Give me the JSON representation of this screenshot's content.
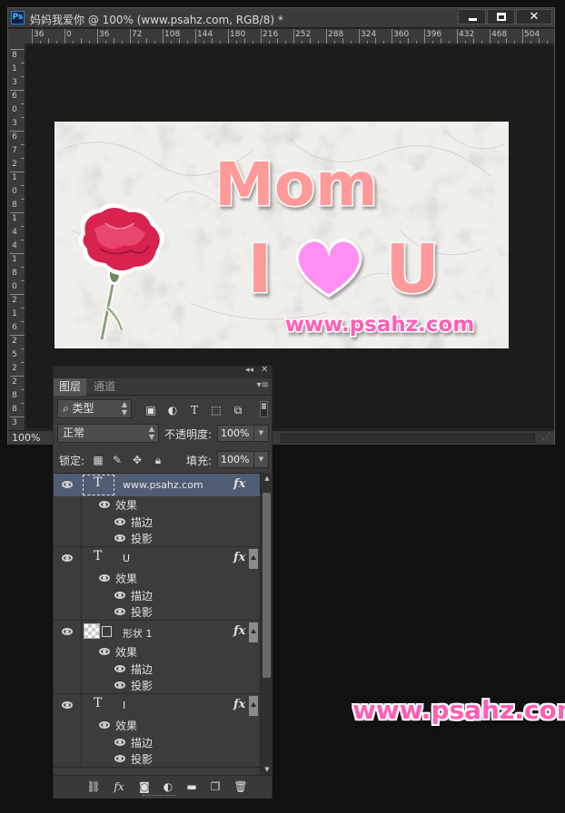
{
  "document": {
    "app_icon_label": "Ps",
    "title": "妈妈我爱你 @ 100% (www.psahz.com, RGB/8) *",
    "zoom": "100%",
    "h_ruler_labels": [
      "36",
      "0",
      "36",
      "72",
      "108",
      "144",
      "180",
      "216",
      "252",
      "288",
      "324",
      "360",
      "396",
      "432",
      "468",
      "504"
    ],
    "v_ruler_labels": [
      "8",
      "1",
      "3",
      "6",
      "0",
      "3",
      "6",
      "7",
      "2",
      "1",
      "0",
      "8",
      "1",
      "4",
      "4",
      "1",
      "8",
      "0",
      "2",
      "1",
      "6",
      "2",
      "5",
      "2",
      "2",
      "8",
      "8",
      "3"
    ]
  },
  "artwork": {
    "line1": "Mom",
    "line2_left": "I",
    "line2_right": "U",
    "url": "www.psahz.com",
    "heart_color": "#ff8ff0",
    "text_color": "#ff9a9a",
    "url_color": "#ff5fb4"
  },
  "layers_panel": {
    "tabs": [
      "图层",
      "通道"
    ],
    "filter_kind": "类型",
    "blend_mode": "正常",
    "opacity_label": "不透明度:",
    "opacity_value": "100%",
    "lock_label": "锁定:",
    "fill_label": "填充:",
    "fill_value": "100%",
    "fx_label": "fx",
    "layers": [
      {
        "name": "www.psahz.com",
        "kind": "text",
        "selected": true,
        "effects_label": "效果",
        "effects": [
          "描边",
          "投影"
        ]
      },
      {
        "name": "U",
        "kind": "text",
        "selected": false,
        "effects_label": "效果",
        "effects": [
          "描边",
          "投影"
        ]
      },
      {
        "name": "形状 1",
        "kind": "shape",
        "selected": false,
        "effects_label": "效果",
        "effects": [
          "描边",
          "投影"
        ]
      },
      {
        "name": "I",
        "kind": "text",
        "selected": false,
        "effects_label": "效果",
        "effects": [
          "描边",
          "投影"
        ]
      }
    ],
    "footer_icons": [
      "link-icon",
      "fx-icon",
      "mask-icon",
      "adjustment-icon",
      "folder-icon",
      "new-layer-icon",
      "trash-icon"
    ]
  },
  "watermark": "www.psahz.com"
}
